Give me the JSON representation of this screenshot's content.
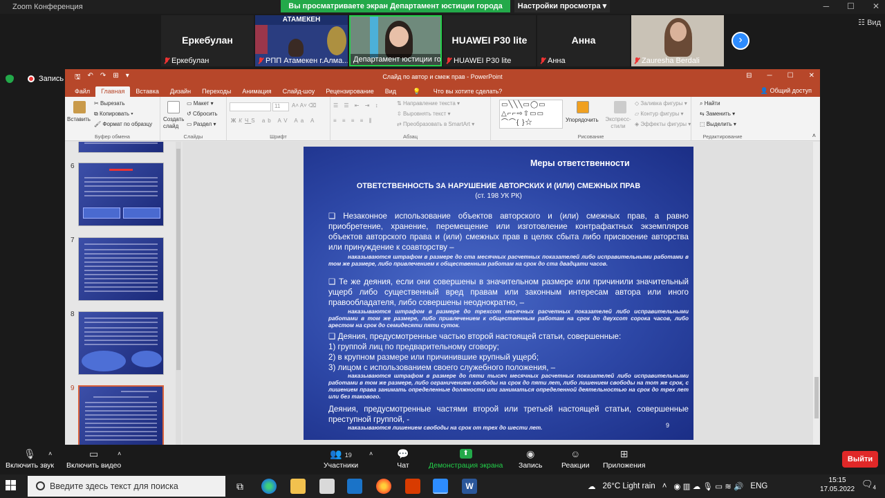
{
  "zoom": {
    "window_title": "Zoom Конференция",
    "share_banner": "Вы просматриваете экран Департамент юстиции города Алм...",
    "view_settings": "Настройки просмотра",
    "view_label": "Вид",
    "record_label": "Запись",
    "participants": [
      {
        "display": "Еркебулан",
        "label": "Еркебулан"
      },
      {
        "display": "",
        "label": "РПП Атамекен г.Алма..."
      },
      {
        "display": "",
        "label": "Департамент юстиции го..."
      },
      {
        "display": "HUAWEI P30 lite",
        "label": "HUAWEI P30 lite"
      },
      {
        "display": "Анна",
        "label": "Анна"
      },
      {
        "display": "",
        "label": "Zauresha Berdali"
      }
    ],
    "atameken_text": "АТАМЕКЕН"
  },
  "ppt": {
    "title": "Слайд по автор и смеж прав - PowerPoint",
    "tabs": [
      "Файл",
      "Главная",
      "Вставка",
      "Дизайн",
      "Переходы",
      "Анимация",
      "Слайд-шоу",
      "Рецензирование",
      "Вид"
    ],
    "tell_me": "Что вы хотите сделать?",
    "share": "Общий доступ",
    "ribbon": {
      "paste": "Вставить",
      "cut": "Вырезать",
      "copy": "Копировать",
      "format_painter": "Формат по образцу",
      "clipboard": "Буфер обмена",
      "new_slide": "Создать слайд",
      "layout": "Макет",
      "reset": "Сбросить",
      "section": "Раздел",
      "slides": "Слайды",
      "font_size": "11",
      "font_group": "Шрифт",
      "text_direction": "Направление текста",
      "align_text": "Выровнять текст",
      "smartart": "Преобразовать в SmartArt",
      "paragraph": "Абзац",
      "arrange": "Упорядочить",
      "quick_styles": "Экспресс-стили",
      "shape_fill": "Заливка фигуры",
      "shape_outline": "Контур фигуры",
      "shape_effects": "Эффекты фигуры",
      "drawing": "Рисование",
      "find": "Найти",
      "replace": "Заменить",
      "select": "Выделить",
      "editing": "Редактирование"
    },
    "thumb_numbers": [
      "6",
      "7",
      "8",
      "9"
    ]
  },
  "slide": {
    "header": "Меры ответственности",
    "title": "ОТВЕТСТВЕННОСТЬ ЗА  НАРУШЕНИЕ АВТОРСКИХ И (ИЛИ) СМЕЖНЫХ ПРАВ",
    "subtitle": "(ст. 198 УК РК)",
    "p1": "❑        Незаконное использование объектов авторского и (или) смежных прав, а равно приобретение, хранение, перемещение или изготовление контрафактных экземпляров объектов авторского права и (или) смежных прав в целях сбыта либо присвоение авторства или принуждение к соавторству –",
    "p1_penalty": "наказываются штрафом в размере до ста месячных расчетных показателей либо исправительными работами в том же размере, либо привлечением к общественным работам на срок до ста двадцати часов.",
    "p2": "❑   Те же деяния, если они совершены в значительном размере или причинили значительный ущерб либо существенный вред правам или законным интересам автора или иного правообладателя, либо совершены неоднократно, –",
    "p2_penalty": "наказываются штрафом в размере до трехсот месячных расчетных показателей либо исправительными работами в том же размере, либо привлечением к общественным работам на срок до двухсот сорока часов, либо арестом на срок до семидесяти пяти суток.",
    "p3": "❑   Деяния, предусмотренные частью второй настоящей статьи, совершенные:",
    "list": [
      "1)     группой лиц по предварительному сговору;",
      "2)     в крупном размере или причинившие крупный ущерб;",
      "3)     лицом с использованием своего служебного положения, –"
    ],
    "p3_penalty": "наказываются штрафом в размере до пяти тысяч месячных расчетных показателей либо исправительными работами в том же размере, либо ограничением свободы на срок до пяти лет, либо лишением свободы на тот же срок, с лишением права занимать определенные должности или заниматься определенной деятельностью на срок до трех лет или без такового.",
    "p4": "      Деяния, предусмотренные частями второй или третьей настоящей статьи, совершенные преступной группой, -",
    "p4_penalty": "наказываются лишением свободы на срок от трех до шести лет.",
    "page_number": "9"
  },
  "toolbar": {
    "unmute": "Включить звук",
    "start_video": "Включить видео",
    "participants": "Участники",
    "participants_count": "19",
    "chat": "Чат",
    "share_screen": "Демонстрация экрана",
    "record": "Запись",
    "reactions": "Реакции",
    "apps": "Приложения",
    "leave": "Выйти"
  },
  "taskbar": {
    "search_placeholder": "Введите здесь текст для поиска",
    "weather": "26°C  Light rain",
    "lang": "ENG",
    "time": "15:15",
    "date": "17.05.2022",
    "notif_count": "4"
  },
  "colors": {
    "ppt_accent": "#b7472a",
    "zoom_green": "#23a94a",
    "zoom_blue": "#2d8cff",
    "slide_blue": "#2d47a6"
  }
}
